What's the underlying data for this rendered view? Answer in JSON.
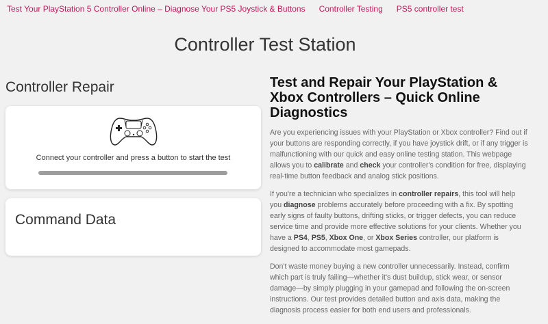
{
  "nav": {
    "links": [
      "Test Your PlayStation 5 Controller Online – Diagnose Your PS5 Joystick & Buttons",
      "Controller Testing",
      "PS5 controller test"
    ]
  },
  "page": {
    "title": "Controller Test Station"
  },
  "repair": {
    "heading": "Controller Repair",
    "icon": "gamepad-icon",
    "prompt": "Connect your controller and press a button to start the test",
    "progress_percent": 100
  },
  "command": {
    "heading": "Command Data"
  },
  "article": {
    "title": "Test and Repair Your PlayStation & Xbox Controllers – Quick Online Diagnostics",
    "p1": [
      "Are you experiencing issues with your PlayStation or Xbox controller? Find out if your buttons are responding correctly, if you have joystick drift, or if any trigger is malfunctioning with our quick and easy online testing station. This webpage allows you to ",
      "calibrate",
      " and ",
      "check",
      " your controller's condition for free, displaying real-time button feedback and analog stick positions."
    ],
    "p2": [
      "If you're a technician who specializes in ",
      "controller repairs",
      ", this tool will help you ",
      "diagnose",
      " problems accurately before proceeding with a fix. By spotting early signs of faulty buttons, drifting sticks, or trigger defects, you can reduce service time and provide more effective solutions for your clients. Whether you have a ",
      "PS4",
      ", ",
      "PS5",
      ", ",
      "Xbox One",
      ", or ",
      "Xbox Series",
      " controller, our platform is designed to accommodate most gamepads."
    ],
    "p3": "Don't waste money buying a new controller unnecessarily. Instead, confirm which part is truly failing—whether it's dust buildup, stick wear, or sensor damage—by simply plugging in your gamepad and following the on-screen instructions. Our test provides detailed button and axis data, making the diagnosis process easier for both end users and professionals."
  }
}
